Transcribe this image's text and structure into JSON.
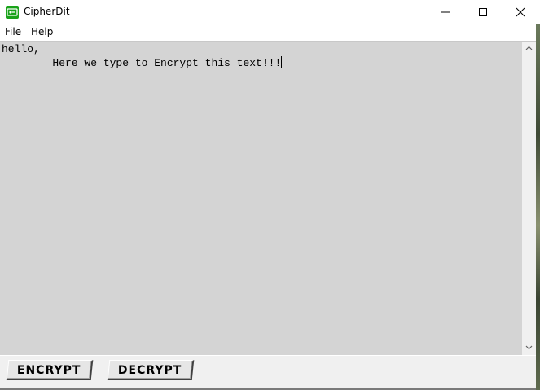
{
  "window": {
    "title": "CipherDit",
    "icon": "cipherdit-app-icon",
    "controls": [
      "minimize-icon",
      "maximize-icon",
      "close-icon"
    ]
  },
  "menu": {
    "file_label": "File",
    "help_label": "Help"
  },
  "editor": {
    "line1": "hello,",
    "line2": "        Here we type to Encrypt this text!!!"
  },
  "actions": {
    "encrypt_label": "ENCRYPT",
    "decrypt_label": "DECRYPT"
  },
  "colors": {
    "editor_background": "#d4d4d4",
    "app_icon": "#1aa31a"
  }
}
